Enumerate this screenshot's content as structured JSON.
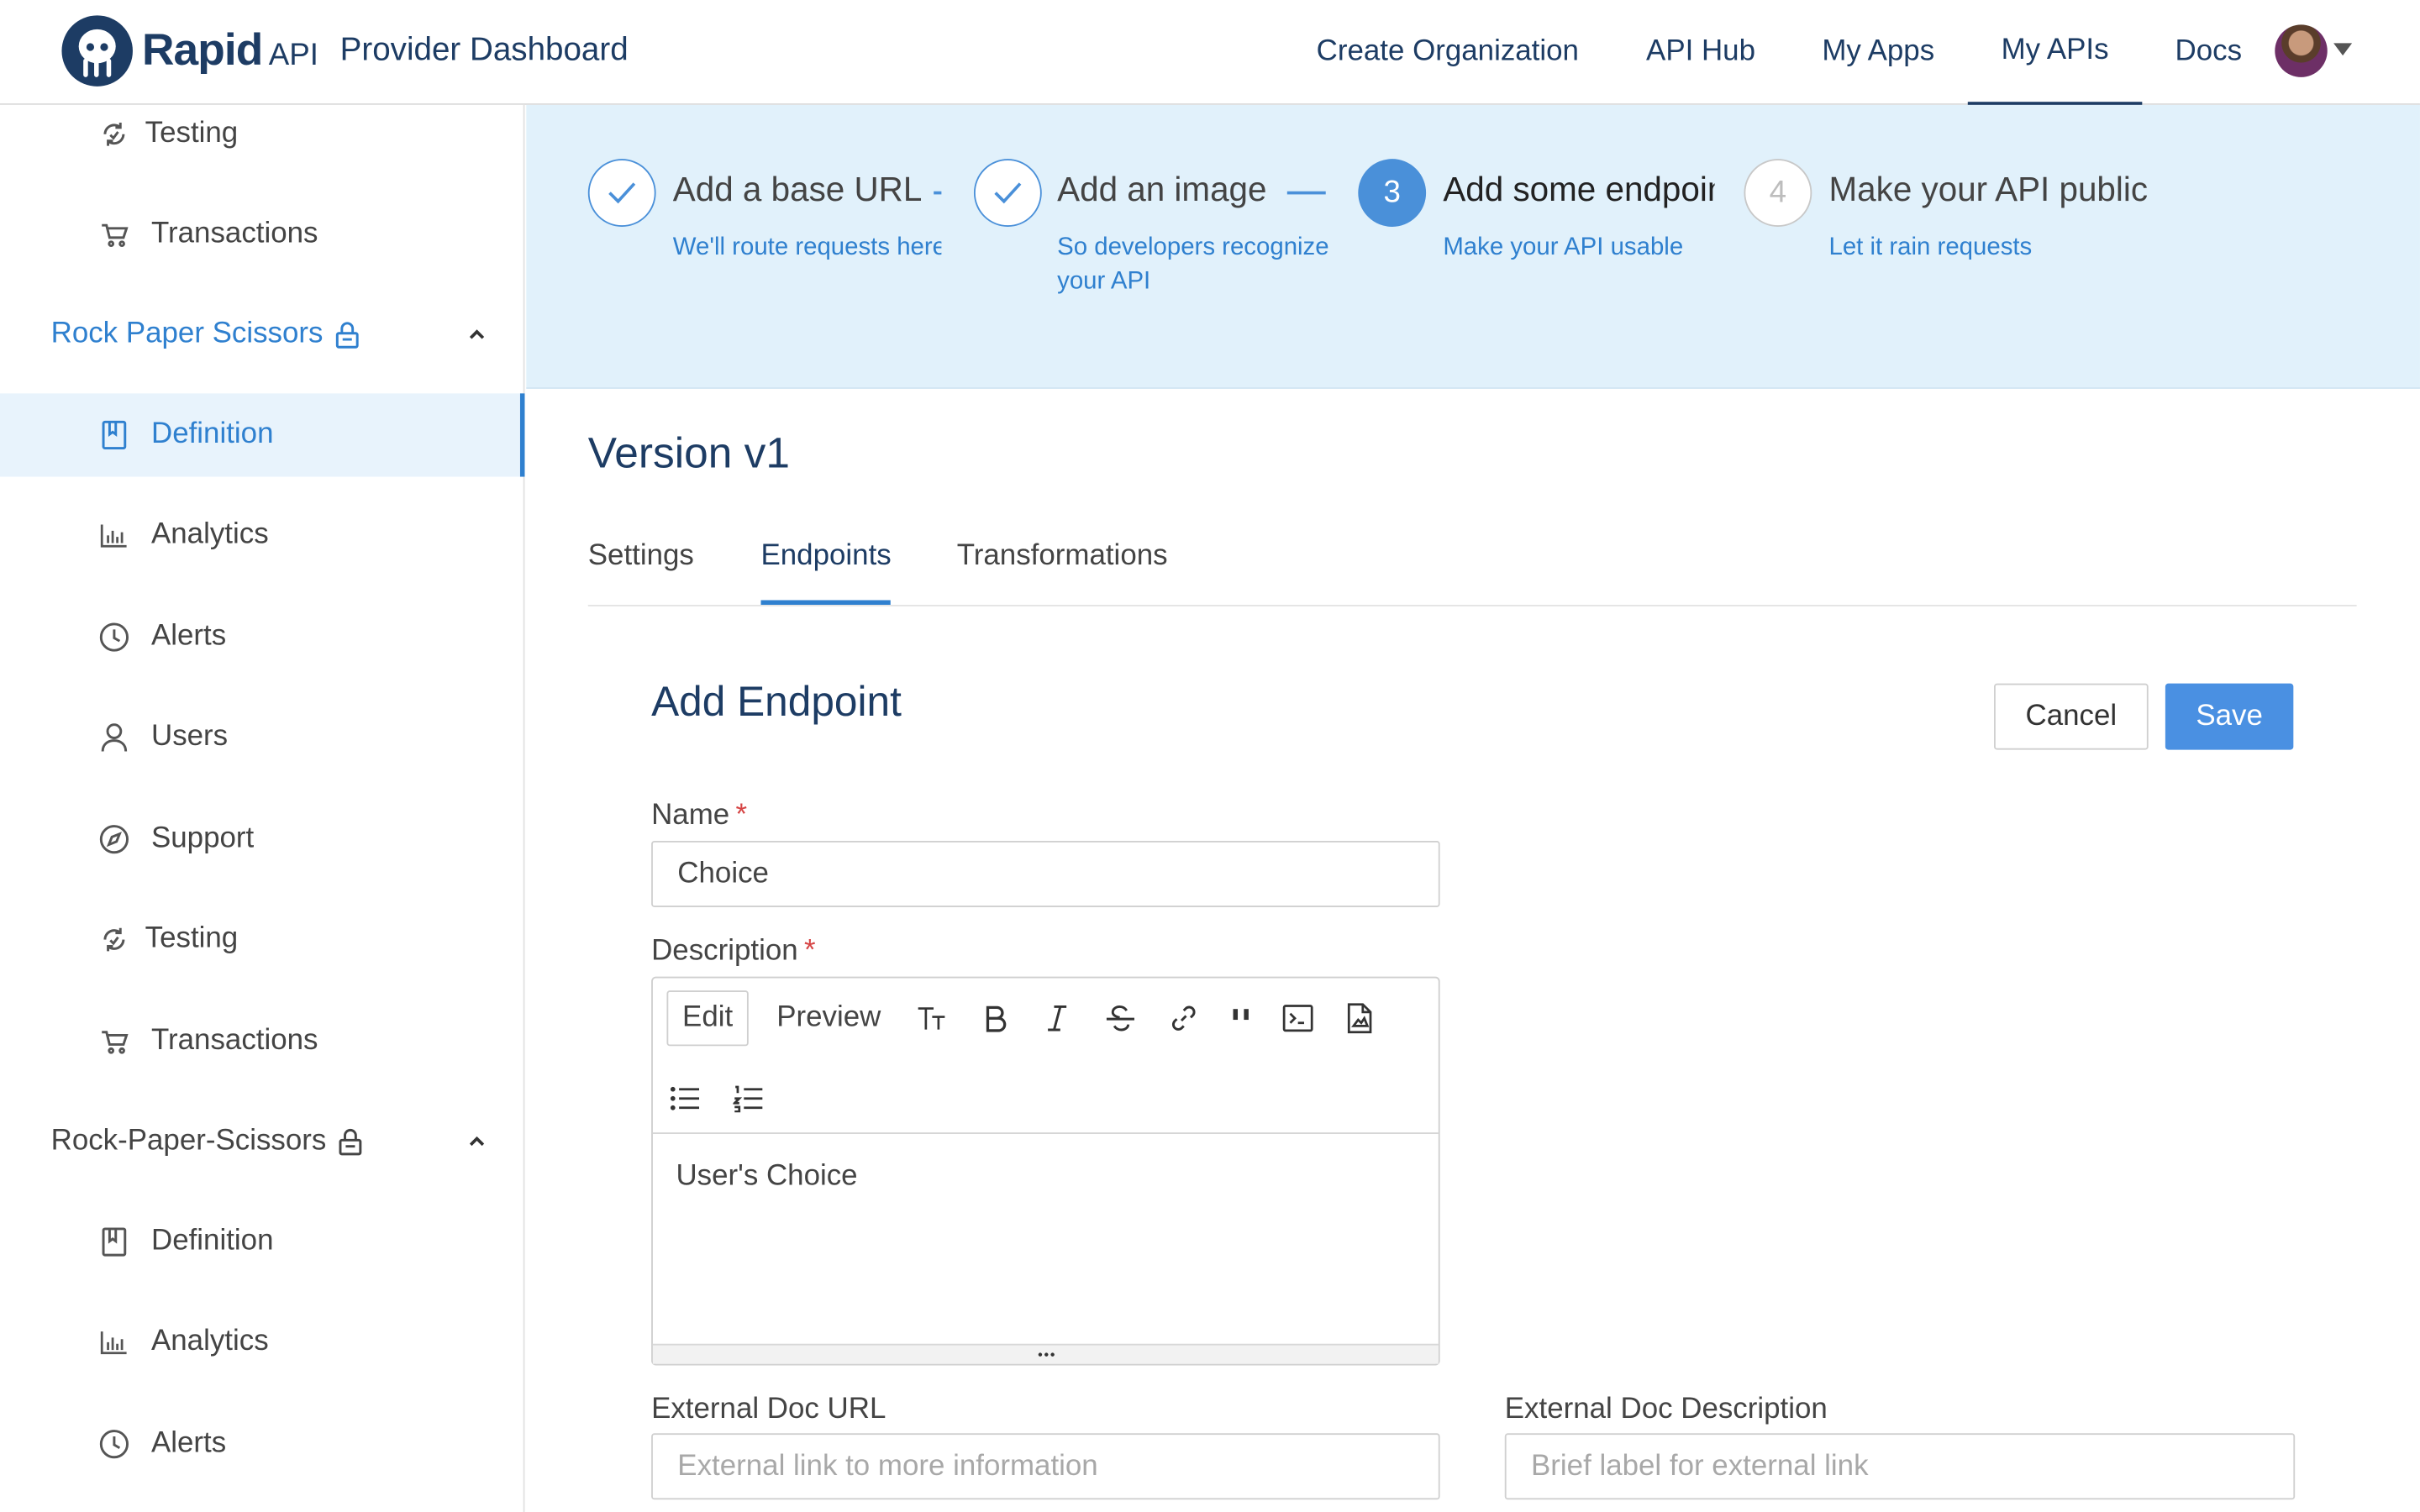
{
  "header": {
    "brand": "Rapid",
    "brand_suffix": "API",
    "title": "Provider Dashboard",
    "nav": [
      "Create Organization",
      "API Hub",
      "My Apps",
      "My APIs",
      "Docs"
    ],
    "active_nav": "My APIs"
  },
  "sidebar": {
    "top_items": [
      {
        "label": "Testing",
        "icon": "testing-icon"
      },
      {
        "label": "Transactions",
        "icon": "cart-icon"
      }
    ],
    "groups": [
      {
        "name": "Rock Paper Scissors",
        "color": "#2f80cf",
        "locked": true,
        "expanded": true,
        "items": [
          {
            "label": "Definition",
            "icon": "book-icon",
            "active": true
          },
          {
            "label": "Analytics",
            "icon": "bar-chart-icon"
          },
          {
            "label": "Alerts",
            "icon": "clock-icon"
          },
          {
            "label": "Users",
            "icon": "user-icon"
          },
          {
            "label": "Support",
            "icon": "compass-icon"
          },
          {
            "label": "Testing",
            "icon": "testing-icon"
          },
          {
            "label": "Transactions",
            "icon": "cart-icon"
          }
        ]
      },
      {
        "name": "Rock-Paper-Scissors",
        "color": "#444444",
        "locked": true,
        "expanded": true,
        "items": [
          {
            "label": "Definition",
            "icon": "book-icon"
          },
          {
            "label": "Analytics",
            "icon": "bar-chart-icon"
          },
          {
            "label": "Alerts",
            "icon": "clock-icon"
          }
        ]
      }
    ]
  },
  "stepper": {
    "steps": [
      {
        "title": "Add a base URL",
        "subtitle": "We'll route requests here",
        "state": "done"
      },
      {
        "title": "Add an image",
        "subtitle": "So developers recognize your API",
        "state": "done"
      },
      {
        "number": "3",
        "title": "Add some endpoints",
        "subtitle": "Make your API usable",
        "state": "current"
      },
      {
        "number": "4",
        "title": "Make your API public",
        "subtitle": "Let it rain requests",
        "state": "todo"
      }
    ]
  },
  "main": {
    "version_title": "Version v1",
    "tabs": [
      "Settings",
      "Endpoints",
      "Transformations"
    ],
    "active_tab": "Endpoints"
  },
  "form": {
    "title": "Add Endpoint",
    "cancel_label": "Cancel",
    "save_label": "Save",
    "name_label": "Name",
    "name_value": "Choice",
    "required_mark": "*",
    "description_label": "Description",
    "editor": {
      "edit_label": "Edit",
      "preview_label": "Preview",
      "content": "User's Choice",
      "toolbar_icons": [
        "text-size-icon",
        "bold-icon",
        "italic-icon",
        "strikethrough-icon",
        "link-icon",
        "quote-icon",
        "code-icon",
        "file-icon",
        "bulleted-list-icon",
        "numbered-list-icon"
      ]
    },
    "external_doc_url_label": "External Doc URL",
    "external_doc_url_placeholder": "External link to more information",
    "external_doc_description_label": "External Doc Description",
    "external_doc_description_placeholder": "Brief label for external link"
  },
  "colors": {
    "brand_navy": "#1d3c64",
    "accent_blue": "#2f80cf",
    "save_button": "#4a90e2",
    "stepper_bg": "#e1f1fb"
  }
}
